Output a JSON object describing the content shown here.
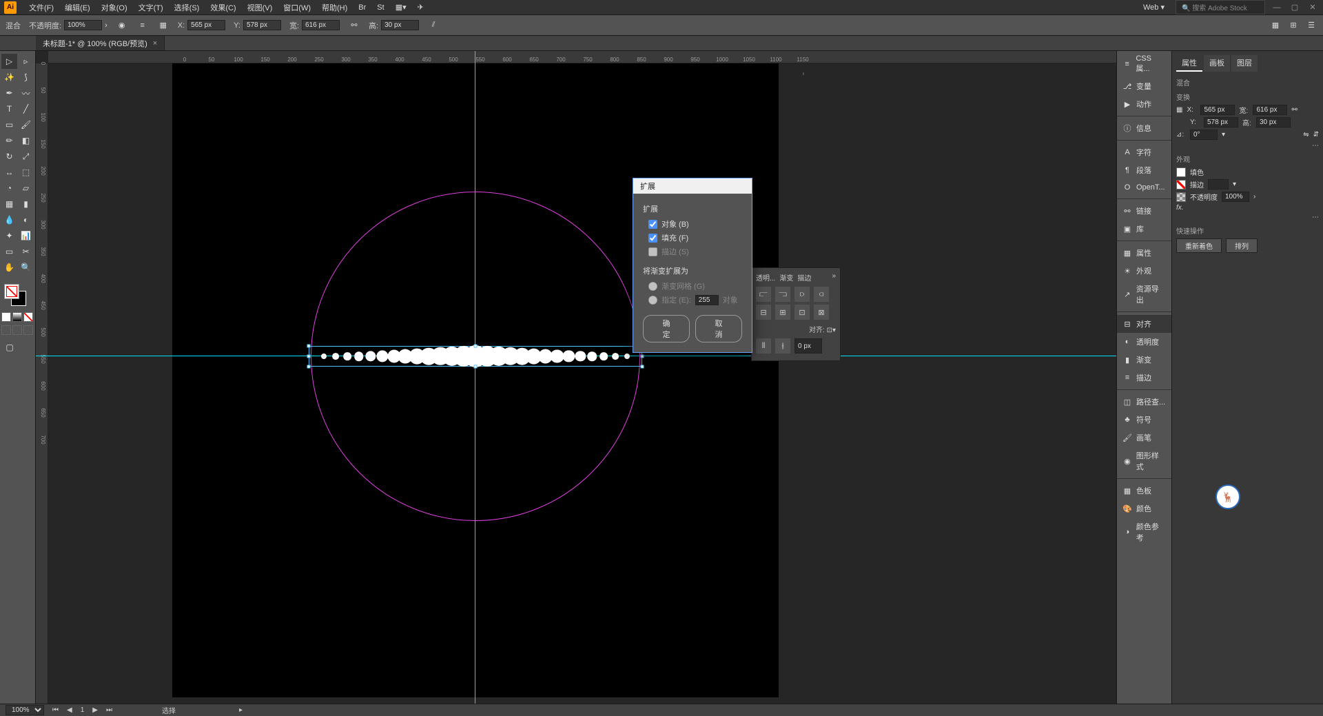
{
  "app": {
    "icon_text": "Ai"
  },
  "menu": {
    "file": "文件(F)",
    "edit": "编辑(E)",
    "object": "对象(O)",
    "type": "文字(T)",
    "select": "选择(S)",
    "effect": "效果(C)",
    "view": "视图(V)",
    "window": "窗口(W)",
    "help": "帮助(H)",
    "workspace": "Web",
    "search_placeholder": "搜索 Adobe Stock"
  },
  "control": {
    "blend_label": "混合",
    "opacity_label": "不透明度:",
    "opacity_value": "100%",
    "x_label": "X:",
    "x_value": "565 px",
    "y_label": "Y:",
    "y_value": "578 px",
    "w_label": "宽:",
    "w_value": "616 px",
    "h_label": "高:",
    "h_value": "30 px"
  },
  "document": {
    "tab_title": "未标题-1* @ 100% (RGB/预览)"
  },
  "ruler": {
    "h_ticks": [
      0,
      50,
      100,
      150,
      200,
      250,
      300,
      350,
      400,
      450,
      500,
      550,
      600,
      650,
      700,
      750,
      800,
      850,
      900,
      950,
      1000,
      1050,
      1100,
      1150
    ],
    "v_ticks": [
      0,
      50,
      100,
      150,
      200,
      250,
      300,
      350,
      400,
      450,
      500,
      550,
      600,
      650,
      700
    ]
  },
  "dialog": {
    "title": "扩展",
    "section1": "扩展",
    "opt_object": "对象 (B)",
    "opt_fill": "填充 (F)",
    "opt_stroke": "描边 (S)",
    "section2": "将渐变扩展为",
    "opt_mesh": "渐变网格 (G)",
    "opt_specify": "指定 (E):",
    "specify_value": "255",
    "specify_unit": "对象",
    "ok": "确定",
    "cancel": "取消"
  },
  "strip": {
    "css": "CSS 属...",
    "vars": "变量",
    "actions": "动作",
    "info": "信息",
    "char": "字符",
    "para": "段落",
    "opentype": "OpenT...",
    "links": "链接",
    "lib": "库",
    "props": "属性",
    "appearance": "外观",
    "asset_export": "资源导出",
    "align": "对齐",
    "transparency": "透明度",
    "gradient": "渐变",
    "stroke": "描边",
    "pathfinder": "路径查...",
    "symbols": "符号",
    "brushes": "画笔",
    "graphic_styles": "图形样式",
    "swatches": "色板",
    "color": "颜色",
    "color_guide": "颜色参考"
  },
  "panel": {
    "tab_props": "属性",
    "tab_artboards": "画板",
    "tab_layers": "图层",
    "sec_blend": "混合",
    "sec_transform": "变换",
    "x_label": "X:",
    "x_value": "565 px",
    "w_label": "宽:",
    "w_value": "616 px",
    "y_label": "Y:",
    "y_value": "578 px",
    "h_label": "高:",
    "h_value": "30 px",
    "angle_label": "⊿:",
    "angle_value": "0°",
    "sec_appearance": "外观",
    "fill_label": "填色",
    "stroke_label": "描边",
    "opacity_label": "不透明度",
    "opacity_value": "100%",
    "fx_label": "fx.",
    "sec_quick": "快速操作",
    "btn_recolor": "重新着色",
    "btn_arrange": "排列"
  },
  "align_peek": {
    "tabs": [
      "透明...",
      "渐变",
      "描边"
    ],
    "align_to": "对齐:"
  },
  "statusbar": {
    "zoom": "100%",
    "mode": "选择"
  }
}
